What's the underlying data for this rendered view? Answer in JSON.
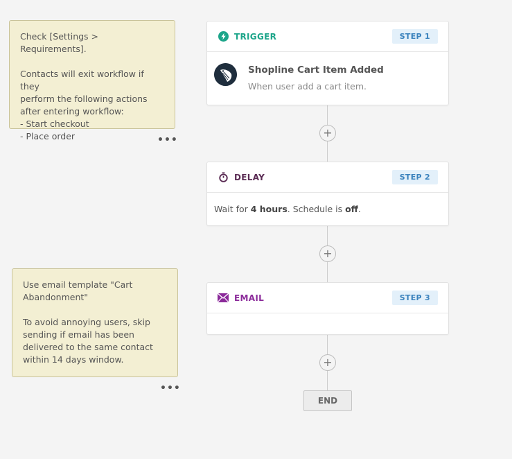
{
  "notes": [
    {
      "para1": "Check [Settings > Requirements].",
      "para2": "Contacts will exit workflow if they\nperform the following actions\nafter entering workflow:\n- Start checkout\n- Place order",
      "more": "•••"
    },
    {
      "para1": "Use email template \"Cart\nAbandonment\"",
      "para2": "To avoid annoying users, skip\nsending if email has been\ndelivered to the same contact\nwithin 14 days window.",
      "more": "•••"
    }
  ],
  "steps": {
    "trigger": {
      "title": "TRIGGER",
      "badge": "STEP 1",
      "name": "Shopline Cart Item Added",
      "description": "When user add a cart item.",
      "icon": "lightning-icon",
      "color": "#1da58a"
    },
    "delay": {
      "title": "DELAY",
      "badge": "STEP 2",
      "prefix": "Wait for ",
      "duration": "4 hours",
      "middle": ". Schedule is ",
      "schedule": "off",
      "suffix": ".",
      "icon": "stopwatch-icon",
      "color": "#5b2c54"
    },
    "email": {
      "title": "EMAIL",
      "badge": "STEP 3",
      "icon": "envelope-icon",
      "color": "#8b2a9a"
    }
  },
  "add_label": "+",
  "end_label": "END"
}
